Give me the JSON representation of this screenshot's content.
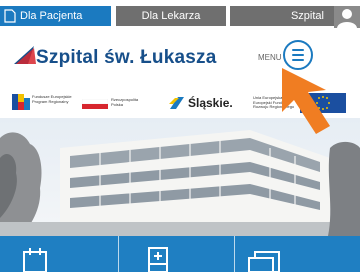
{
  "top_nav": {
    "tab_patient": "Dla Pacjenta",
    "tab_doctor": "Dla Lekarza",
    "tab_hospital": "Szpital"
  },
  "header": {
    "logo_text": "Szpital św. Łukasza",
    "menu_label": "MENU"
  },
  "funding": {
    "fundusze": "Fundusze Europejskie",
    "fundusze_sub": "Program Regionalny",
    "rzeczpospolita": "Rzeczpospolita Polska",
    "slaskie": "Śląskie.",
    "unia": "Unia Europejska",
    "unia_sub": "Europejski Fundusz Rozwoju Regionalnego"
  },
  "bottom_tiles": [
    {
      "icon": "calendar-icon"
    },
    {
      "icon": "calculator-icon"
    },
    {
      "icon": "documents-icon"
    }
  ],
  "colors": {
    "primary_blue": "#1b7ac0",
    "tab_gray": "#6f6f6f",
    "logo_blue": "#174f8a",
    "cursor_orange": "#f07d22"
  }
}
